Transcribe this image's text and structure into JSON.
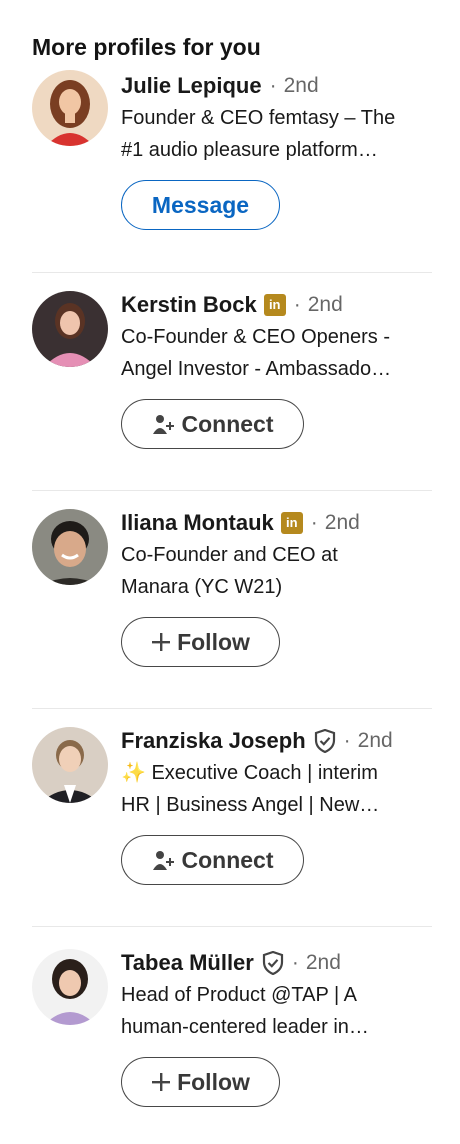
{
  "section_title": "More profiles for you",
  "profiles": [
    {
      "name": "Julie Lepique",
      "degree": "2nd",
      "linkedin_badge": false,
      "verified": false,
      "headline_1": "Founder & CEO femtasy – The",
      "headline_2": "#1 audio pleasure platform…",
      "action_label": "Message",
      "action_type": "message",
      "avatar_colors": [
        "#e9c9a8",
        "#d8332f"
      ]
    },
    {
      "name": "Kerstin Bock",
      "degree": "2nd",
      "linkedin_badge": true,
      "linkedin_badge_text": "in",
      "verified": false,
      "headline_1": "Co-Founder & CEO Openers -",
      "headline_2": "Angel Investor - Ambassado…",
      "action_label": "Connect",
      "action_type": "connect",
      "avatar_colors": [
        "#3a3032",
        "#e58fb5"
      ]
    },
    {
      "name": "Iliana Montauk",
      "degree": "2nd",
      "linkedin_badge": true,
      "linkedin_badge_text": "in",
      "verified": false,
      "headline_1": "Co-Founder and CEO at",
      "headline_2": "Manara (YC W21)",
      "action_label": "Follow",
      "action_type": "follow",
      "avatar_colors": [
        "#8a8a82",
        "#2c2a26"
      ]
    },
    {
      "name": "Franziska Joseph",
      "degree": "2nd",
      "linkedin_badge": false,
      "verified": true,
      "headline_1": "✨ Executive Coach | interim",
      "headline_2": "HR | Business Angel | New…",
      "action_label": "Connect",
      "action_type": "connect",
      "avatar_colors": [
        "#d9cfc4",
        "#1f1f24"
      ]
    },
    {
      "name": "Tabea Müller",
      "degree": "2nd",
      "linkedin_badge": false,
      "verified": true,
      "headline_1": "Head of Product @TAP | A",
      "headline_2": "human-centered leader in…",
      "action_label": "Follow",
      "action_type": "follow",
      "avatar_colors": [
        "#f2f2f2",
        "#b39ad0"
      ]
    }
  ],
  "colors": {
    "primary_blue": "#0a66c2",
    "linkedin_gold": "#b5891e",
    "muted_text": "#666666"
  }
}
